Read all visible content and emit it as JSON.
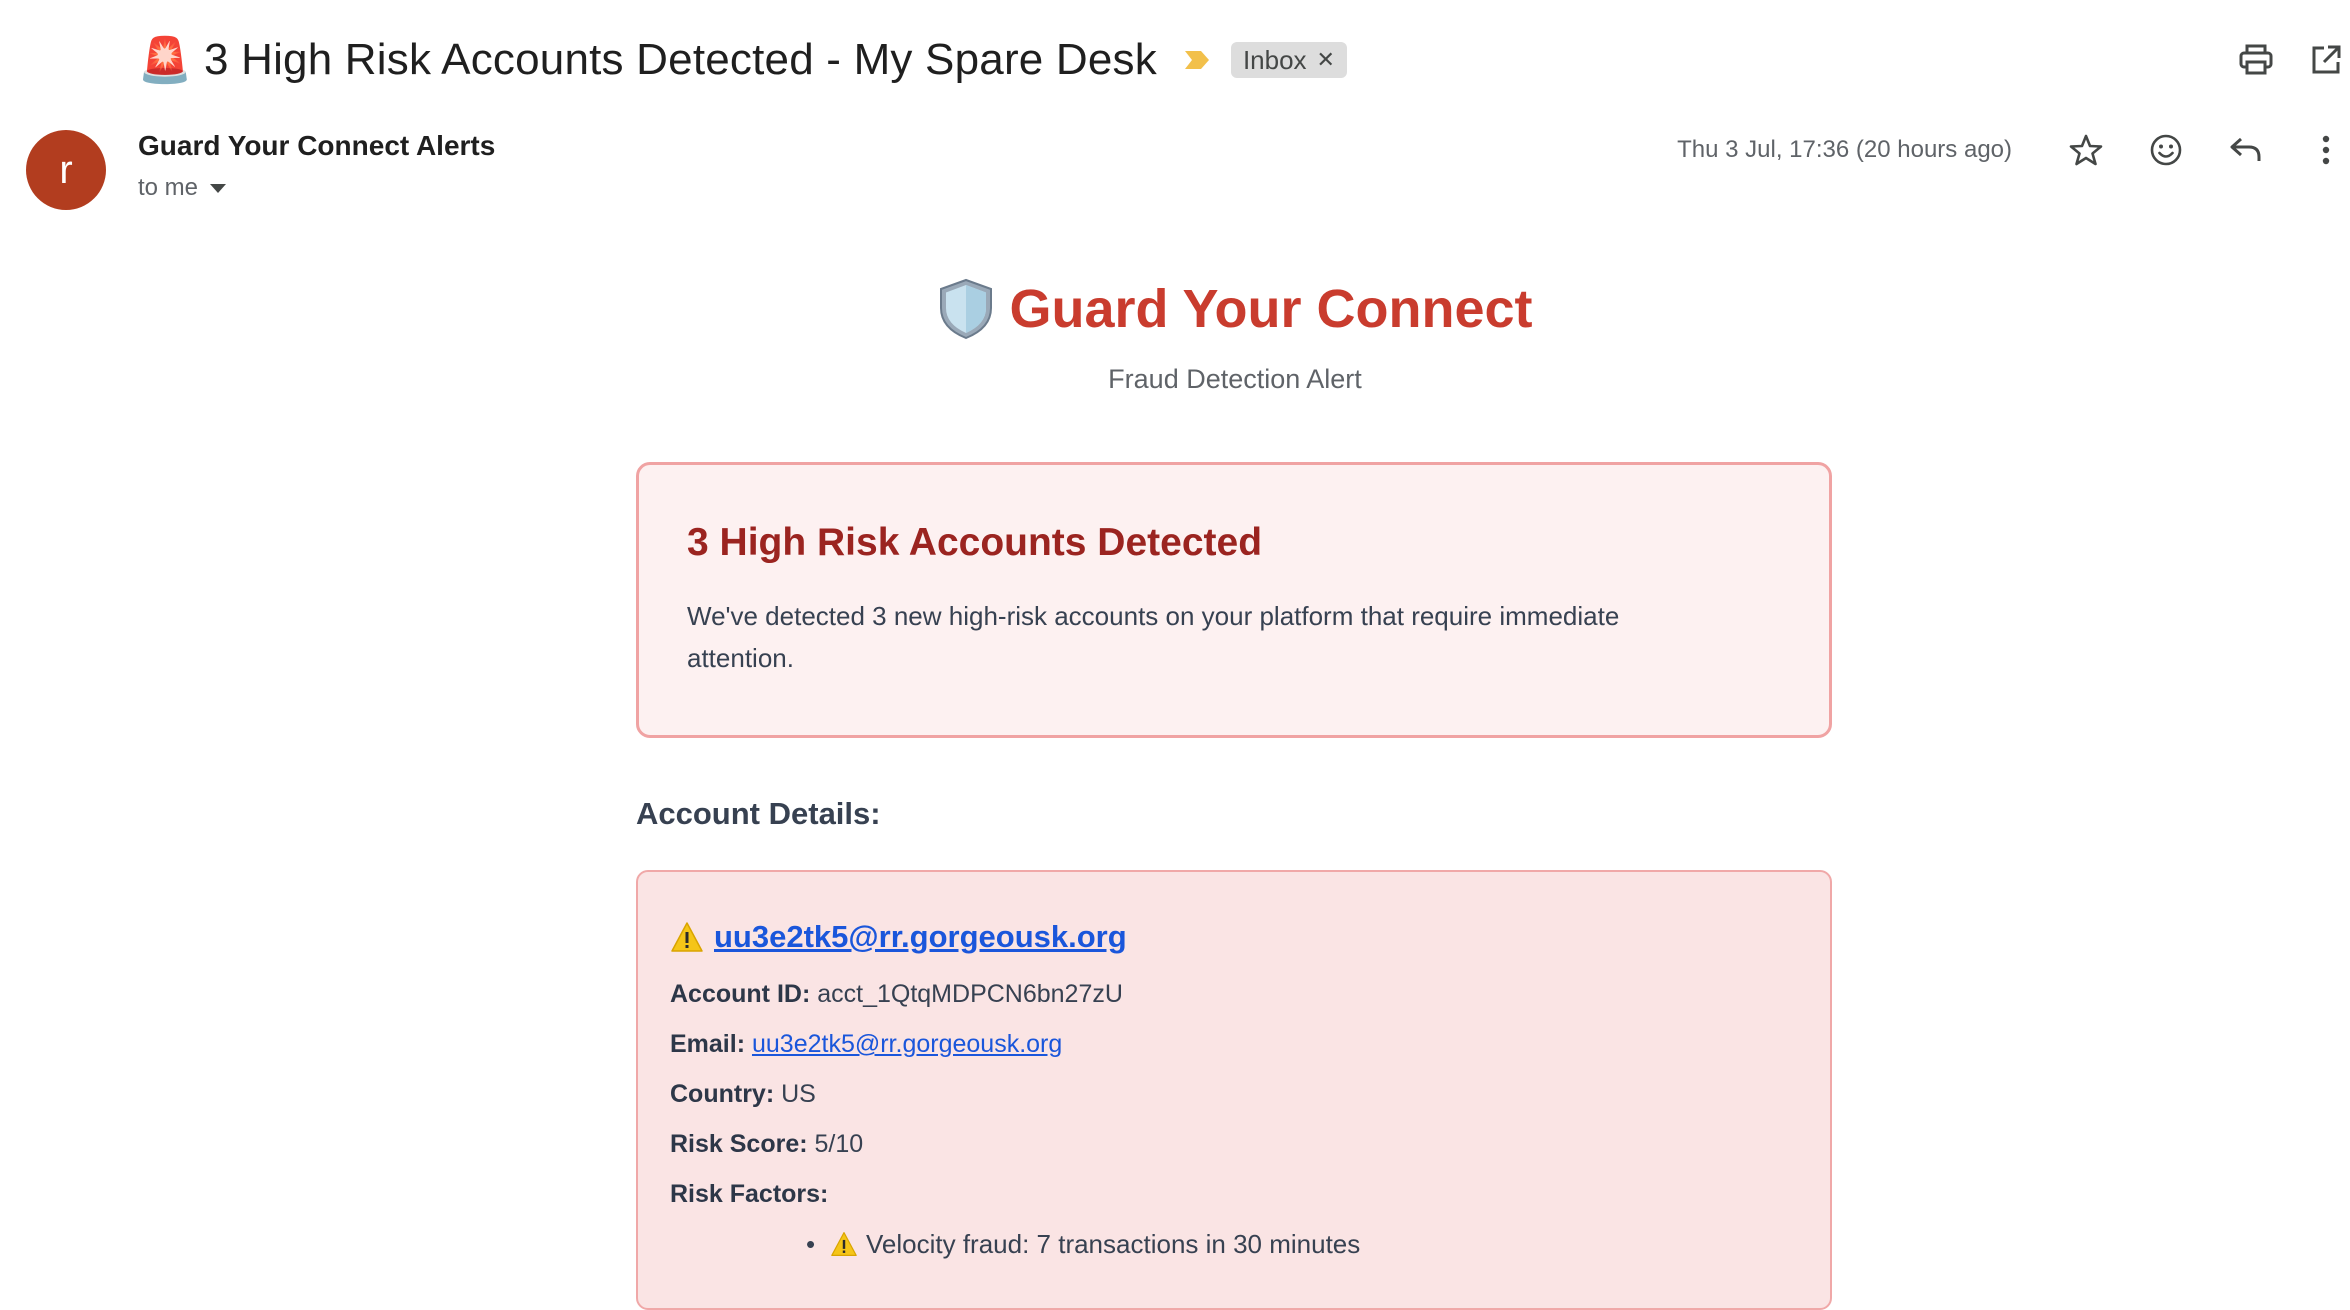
{
  "email": {
    "subject_emoji": "🚨",
    "subject": "3 High Risk Accounts Detected - My Spare Desk",
    "label": "Inbox",
    "sender_initial": "r",
    "sender": "Guard Your Connect Alerts",
    "recipient": "to me",
    "date": "Thu 3 Jul, 17:36 (20 hours ago)"
  },
  "brand": {
    "title": "Guard Your Connect",
    "subtitle": "Fraud Detection Alert"
  },
  "alert": {
    "title": "3 High Risk Accounts Detected",
    "body": "We've detected 3 new high-risk accounts on your platform that require immediate attention."
  },
  "section_title": "Account Details:",
  "account": {
    "email_heading": "uu3e2tk5@rr.gorgeousk.org",
    "account_id_label": "Account ID:",
    "account_id": "acct_1QtqMDPCN6bn27zU",
    "email_label": "Email:",
    "email": "uu3e2tk5@rr.gorgeousk.org",
    "country_label": "Country:",
    "country": "US",
    "risk_score_label": "Risk Score:",
    "risk_score": "5/10",
    "risk_factors_label": "Risk Factors:",
    "risk_factors": [
      "Velocity fraud: 7 transactions in 30 minutes"
    ]
  },
  "colors": {
    "brand_red": "#c93c2e",
    "alert_title": "#9b2420",
    "link_blue": "#1a56db",
    "avatar": "#b23d1f"
  },
  "icons": [
    "siren-icon",
    "importance-marker-icon",
    "close-icon",
    "print-icon",
    "open-in-new-window-icon",
    "star-icon",
    "emoji-reaction-icon",
    "reply-icon",
    "more-options-icon",
    "shield-icon",
    "warning-icon"
  ]
}
